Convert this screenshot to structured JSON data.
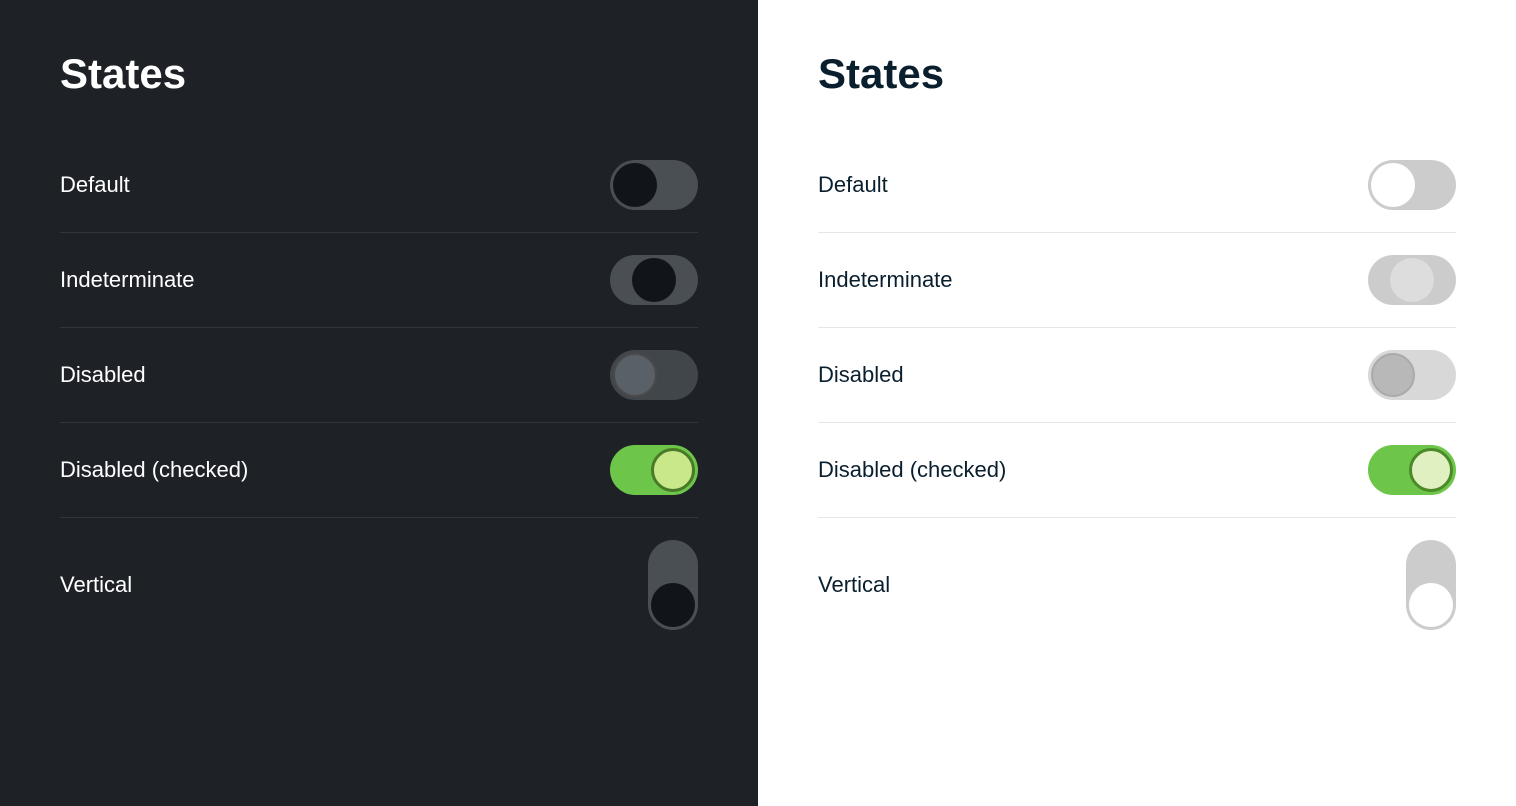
{
  "dark_panel": {
    "title": "States",
    "states": [
      {
        "id": "default",
        "label": "Default"
      },
      {
        "id": "indeterminate",
        "label": "Indeterminate"
      },
      {
        "id": "disabled",
        "label": "Disabled"
      },
      {
        "id": "disabled-checked",
        "label": "Disabled (checked)"
      },
      {
        "id": "vertical",
        "label": "Vertical"
      }
    ]
  },
  "light_panel": {
    "title": "States",
    "states": [
      {
        "id": "default",
        "label": "Default"
      },
      {
        "id": "indeterminate",
        "label": "Indeterminate"
      },
      {
        "id": "disabled",
        "label": "Disabled"
      },
      {
        "id": "disabled-checked",
        "label": "Disabled (checked)"
      },
      {
        "id": "vertical",
        "label": "Vertical"
      }
    ]
  },
  "colors": {
    "dark_bg": "#1e2227",
    "light_bg": "#ffffff",
    "green_active": "#6dc54a",
    "dark_text": "#ffffff",
    "light_text": "#0a1f2e"
  }
}
